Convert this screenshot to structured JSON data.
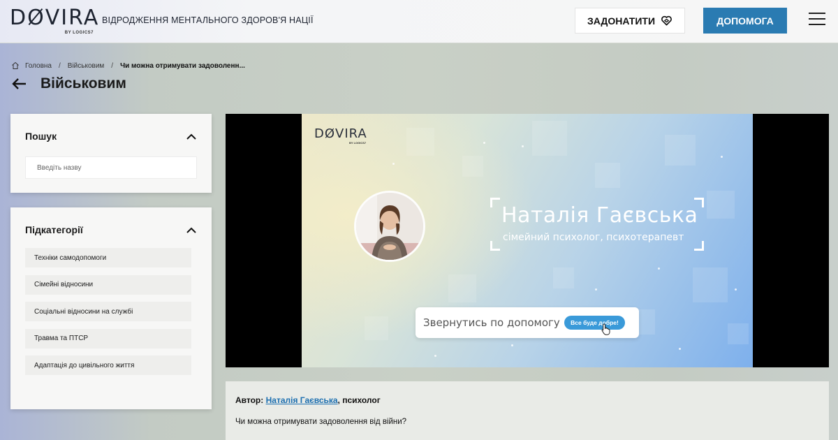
{
  "header": {
    "logo": "DØVIRA",
    "logo_sub": "BY LOGICS7",
    "tagline": "ВІДРОДЖЕННЯ МЕНТАЛЬНОГО ЗДОРОВ'Я НАЦІЇ",
    "donate_label": "ЗАДОНАТИТИ",
    "help_label": "ДОПОМОГА"
  },
  "breadcrumb": {
    "items": [
      "Головна",
      "Військовим"
    ],
    "current": "Чи можна отримувати задоволенн..."
  },
  "page_title": "Військовим",
  "search_panel": {
    "title": "Пошук",
    "placeholder": "Введіть назву"
  },
  "subcategories": {
    "title": "Підкатегорії",
    "items": [
      "Техніки самодопомоги",
      "Сімейні відносини",
      "Соціальні відносини на службі",
      "Травма та ПТСР",
      "Адаптація до цивільного життя"
    ]
  },
  "video": {
    "logo": "DØVIRA",
    "logo_sub": "BY LOGICS7",
    "speaker_name": "Наталія Гаєвська",
    "speaker_role": "сімейний психолог, психотерапевт",
    "cta_text": "Звернутись по допомогу",
    "cta_button": "Все буде добре!"
  },
  "info": {
    "author_label": "Автор:",
    "author_name": "Наталія Гаєвська",
    "author_suffix": ", психолог",
    "question": "Чи можна отримувати задоволення від війни?"
  },
  "colors": {
    "accent": "#2a7bb2",
    "link": "#1c6fb0",
    "cta_button": "#3a9ad9"
  }
}
